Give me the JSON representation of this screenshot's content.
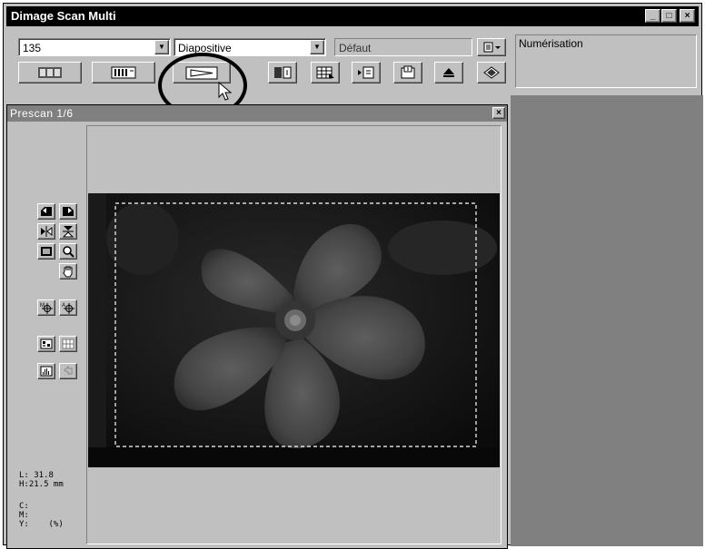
{
  "window": {
    "title": "Dimage Scan Multi"
  },
  "title_buttons": {
    "minimize": "_",
    "maximize": "□",
    "close": "×"
  },
  "toolbar": {
    "film_format": "135",
    "film_type": "Diapositive",
    "setting": "Défaut",
    "status_label": "Numérisation"
  },
  "prescan": {
    "title": "Prescan  1/6",
    "close": "×"
  },
  "info": {
    "length_line": "L: 31.8",
    "height_line": "H:21.5 mm",
    "c_line": "C:",
    "m_line": "M:",
    "y_line": "Y:    (%)"
  },
  "colors": {
    "title_active": "#000000",
    "title_inactive": "#808080",
    "face": "#c0c0c0",
    "workspace": "#808080",
    "image_bg": "#111111",
    "callout_ring": "#000000"
  }
}
